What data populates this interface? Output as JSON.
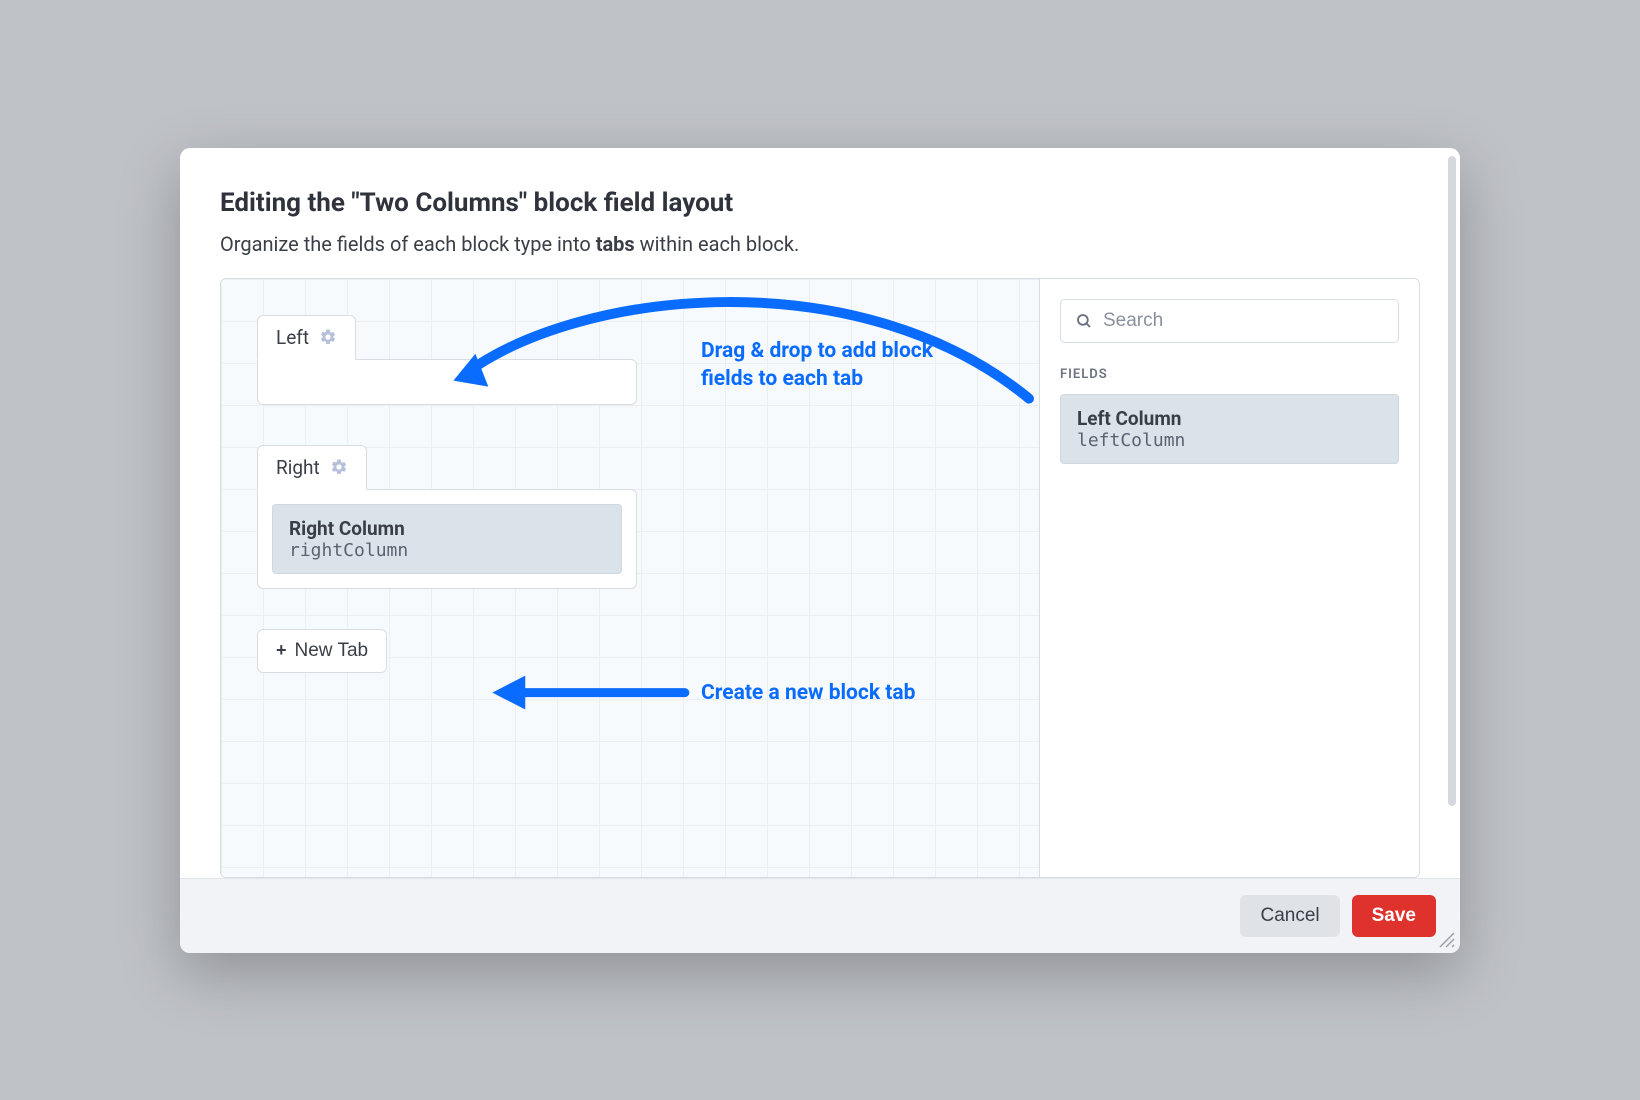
{
  "dialog": {
    "title": "Editing the \"Two Columns\" block field layout",
    "subtitle_before": "Organize the fields of each block type into ",
    "subtitle_bold": "tabs",
    "subtitle_after": " within each block."
  },
  "designer": {
    "tabs": [
      {
        "name": "Left",
        "fields": []
      },
      {
        "name": "Right",
        "fields": [
          {
            "label": "Right Column",
            "handle": "rightColumn"
          }
        ]
      }
    ],
    "new_tab_label": "New Tab"
  },
  "annotations": {
    "drag_drop": "Drag & drop to add block fields to each tab",
    "new_tab": "Create a new block tab"
  },
  "sidebar": {
    "search_placeholder": "Search",
    "section_label": "FIELDS",
    "available_fields": [
      {
        "label": "Left Column",
        "handle": "leftColumn"
      }
    ]
  },
  "footer": {
    "cancel": "Cancel",
    "save": "Save"
  },
  "colors": {
    "accent": "#0a6cff",
    "danger": "#e0322d"
  }
}
